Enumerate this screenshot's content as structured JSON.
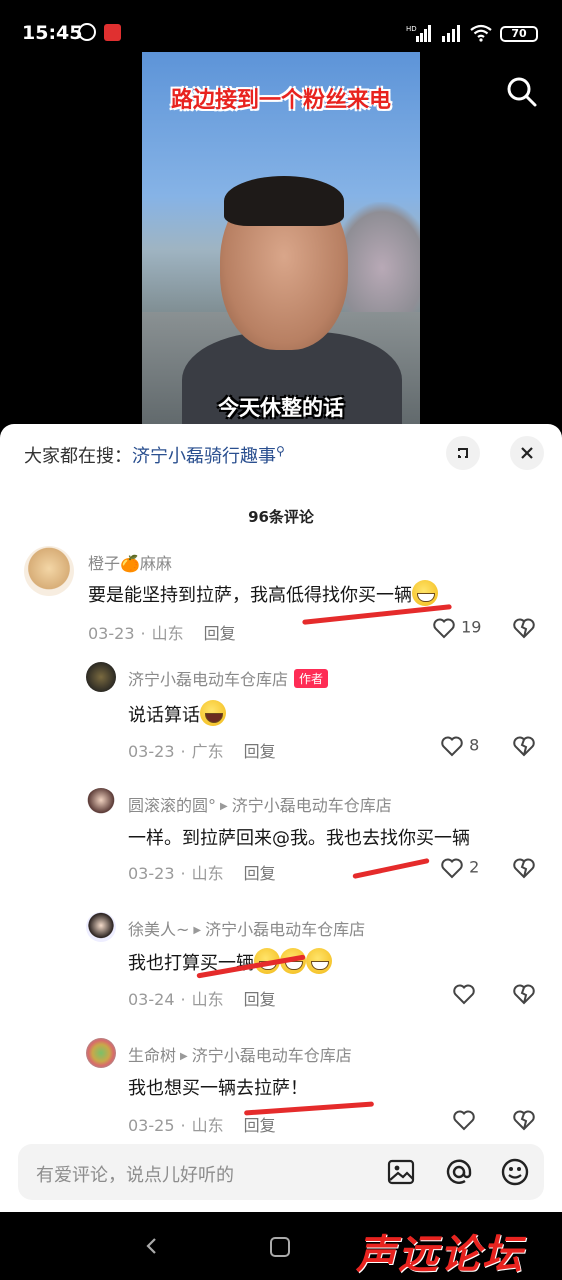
{
  "status_bar": {
    "time": "15:45",
    "battery": "70",
    "network": "HD"
  },
  "video": {
    "title_overlay": "路边接到一个粉丝来电",
    "subtitle_overlay": "今天休整的话"
  },
  "sheet": {
    "search_prefix": "大家都在搜：",
    "search_keyword": "济宁小磊骑行趣事",
    "comment_count": "96条评论"
  },
  "comments": [
    {
      "user": "橙子🍊麻麻",
      "text": "要是能坚持到拉萨，我高低得找你买一辆",
      "date": "03-23",
      "location": "山东",
      "reply_label": "回复",
      "likes": "19"
    },
    {
      "user": "济宁小磊电动车仓库店",
      "author_tag": "作者",
      "text": "说话算话",
      "date": "03-23",
      "location": "广东",
      "reply_label": "回复",
      "likes": "8"
    },
    {
      "user": "圆滚滚的圆°",
      "reply_to": "济宁小磊电动车仓库店",
      "text": "一样。到拉萨回来@我。我也去找你买一辆",
      "date": "03-23",
      "location": "山东",
      "reply_label": "回复",
      "likes": "2"
    },
    {
      "user": "徐美人~",
      "reply_to": "济宁小磊电动车仓库店",
      "text": "我也打算买一辆",
      "date": "03-24",
      "location": "山东",
      "reply_label": "回复",
      "likes": ""
    },
    {
      "user": "生命树",
      "reply_to": "济宁小磊电动车仓库店",
      "text": "我也想买一辆去拉萨！",
      "date": "03-25",
      "location": "山东",
      "reply_label": "回复",
      "likes": ""
    }
  ],
  "input": {
    "placeholder": "有爱评论，说点儿好听的"
  },
  "watermark": "声远论坛",
  "colors": {
    "accent_red": "#fe2c55",
    "keyword_blue": "#2a4f8f",
    "annotation_red": "#e52b2b"
  }
}
